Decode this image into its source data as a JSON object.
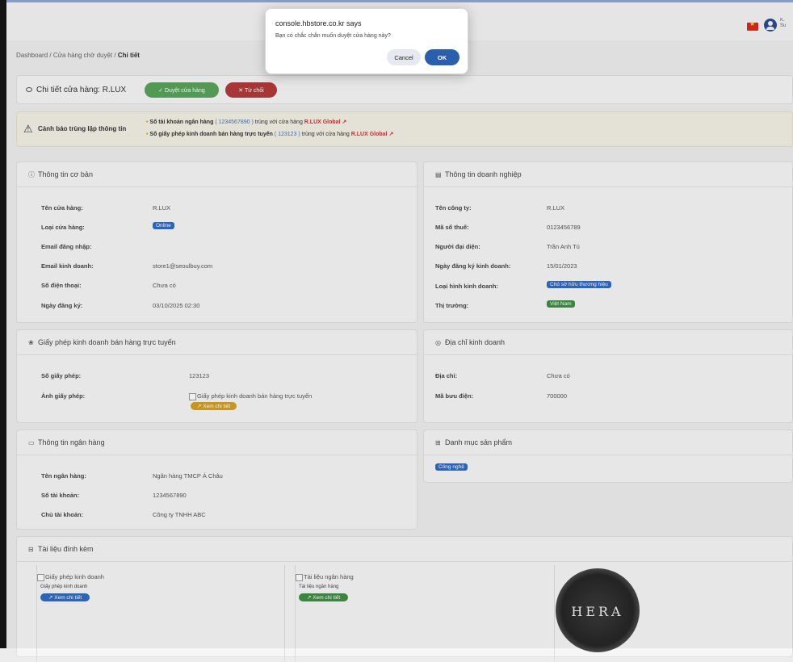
{
  "topbar": {
    "flag": "vietnam-flag",
    "user_initial": "K.",
    "user_sub": "Su"
  },
  "breadcrumb": {
    "item1": "Dashboard",
    "sep": "/",
    "item2": "Cửa hàng chờ duyệt",
    "item3": "Chi tiết"
  },
  "header": {
    "title": "Chi tiết cửa hàng: R.LUX",
    "approve_label": "✓ Duyệt cửa hàng",
    "reject_label": "✕ Từ chối"
  },
  "warning": {
    "label": "Cảnh báo trùng lặp thông tin",
    "line1": {
      "prefix": "Số tài khoản ngân hàng",
      "value": "( 1234567890 )",
      "middle": "trùng với cửa hàng",
      "store": "R.LUX Global",
      "link": "↗"
    },
    "line2": {
      "prefix": "Số giấy phép kinh doanh bán hàng trực tuyến",
      "value": "( 123123 )",
      "middle": "trùng với cửa hàng",
      "store": "R.LUX Global",
      "link": "↗"
    }
  },
  "basic_info": {
    "title": "Thông tin cơ bản",
    "rows": [
      {
        "label": "Tên cửa hàng:",
        "value": "R.LUX"
      },
      {
        "label": "Loại cửa hàng:",
        "value": "Online"
      },
      {
        "label": "Email đăng nhập:",
        "value": ""
      },
      {
        "label": "Email kinh doanh:",
        "value": "store1@seoulbuy.com"
      },
      {
        "label": "Số điện thoại:",
        "value": "Chưa có"
      },
      {
        "label": "Ngày đăng ký:",
        "value": "03/10/2025 02:30"
      }
    ]
  },
  "business_info": {
    "title": "Thông tin doanh nghiệp",
    "rows": [
      {
        "label": "Tên công ty:",
        "value": "R.LUX"
      },
      {
        "label": "Mã số thuế:",
        "value": "0123456789"
      },
      {
        "label": "Người đại diện:",
        "value": "Trần Anh Tú"
      },
      {
        "label": "Ngày đăng ký kinh doanh:",
        "value": "15/01/2023"
      },
      {
        "label": "Loại hình kinh doanh:",
        "value": "Chủ sở hữu thương hiệu"
      },
      {
        "label": "Thị trường:",
        "value": "Việt Nam"
      }
    ]
  },
  "license": {
    "title": "Giấy phép kinh doanh bán hàng trực tuyến",
    "number_label": "Số giấy phép:",
    "number_value": "123123",
    "image_label": "Ảnh giấy phép:",
    "image_alt": "Giấy phép kinh doanh bán hàng trực tuyến",
    "view_label": "↗ Xem chi tiết"
  },
  "address": {
    "title": "Địa chỉ kinh doanh",
    "address_label": "Địa chỉ:",
    "address_value": "Chưa có",
    "postal_label": "Mã bưu điện:",
    "postal_value": "700000"
  },
  "bank": {
    "title": "Thông tin ngân hàng",
    "rows": [
      {
        "label": "Tên ngân hàng:",
        "value": "Ngân hàng TMCP Á Châu"
      },
      {
        "label": "Số tài khoản:",
        "value": "1234567890"
      },
      {
        "label": "Chủ tài khoản:",
        "value": "Công ty TNHH ABC"
      }
    ]
  },
  "categories": {
    "title": "Danh mục sản phẩm",
    "items": [
      "Công nghệ"
    ]
  },
  "attachments": {
    "title": "Tài liệu đính kèm",
    "docs": [
      {
        "alt": "Giấy phép kinh doanh",
        "caption": "Giấy phép kinh doanh",
        "view_label": "↗ Xem chi tiết"
      },
      {
        "alt": "Tài liệu ngân hàng",
        "caption": "Tài liệu ngân hàng",
        "view_label": "↗ Xem chi tiết"
      }
    ],
    "logo_text": "HERA"
  },
  "dialog": {
    "title": "console.hbstore.co.kr says",
    "message": "Bạn có chắc chắn muốn duyệt cửa hàng này?",
    "cancel_label": "Cancel",
    "ok_label": "OK"
  }
}
